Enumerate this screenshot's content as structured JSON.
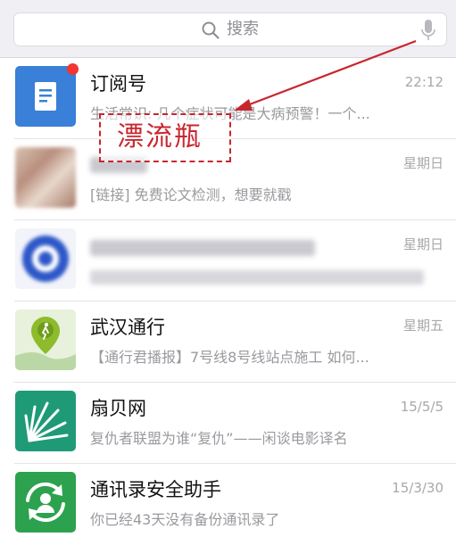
{
  "search": {
    "placeholder": "搜索"
  },
  "chats": [
    {
      "title": "订阅号",
      "time": "22:12",
      "preview": "生活常识: 几个症状可能是大病预警！一个...",
      "unread": true,
      "icon": "subscription-doc-icon",
      "color": "#3a7fd8"
    },
    {
      "title": "",
      "time": "星期日",
      "preview": "[链接] 免费论文检测，想要就戳",
      "blurred_title": true,
      "icon": "blurred-photo-avatar"
    },
    {
      "title": "",
      "time": "星期日",
      "preview": "",
      "blurred_title": true,
      "blurred_preview": true,
      "icon": "blurred-logo-avatar",
      "color": "#2d57c8"
    },
    {
      "title": "武汉通行",
      "time": "星期五",
      "preview": "【通行君播报】7号线8号线站点施工 如何...",
      "icon": "map-pin-walker-icon",
      "color": "#8dbb2c"
    },
    {
      "title": "扇贝网",
      "time": "15/5/5",
      "preview": "复仇者联盟为谁“复仇”——闲谈电影译名",
      "icon": "shanbay-shell-icon",
      "color": "#1f9a77"
    },
    {
      "title": "通讯录安全助手",
      "time": "15/3/30",
      "preview": "你已经43天没有备份通讯录了",
      "icon": "contact-sync-icon",
      "color": "#2ca24e"
    }
  ],
  "annotation": {
    "label": "漂流瓶",
    "color": "#c8262e"
  }
}
